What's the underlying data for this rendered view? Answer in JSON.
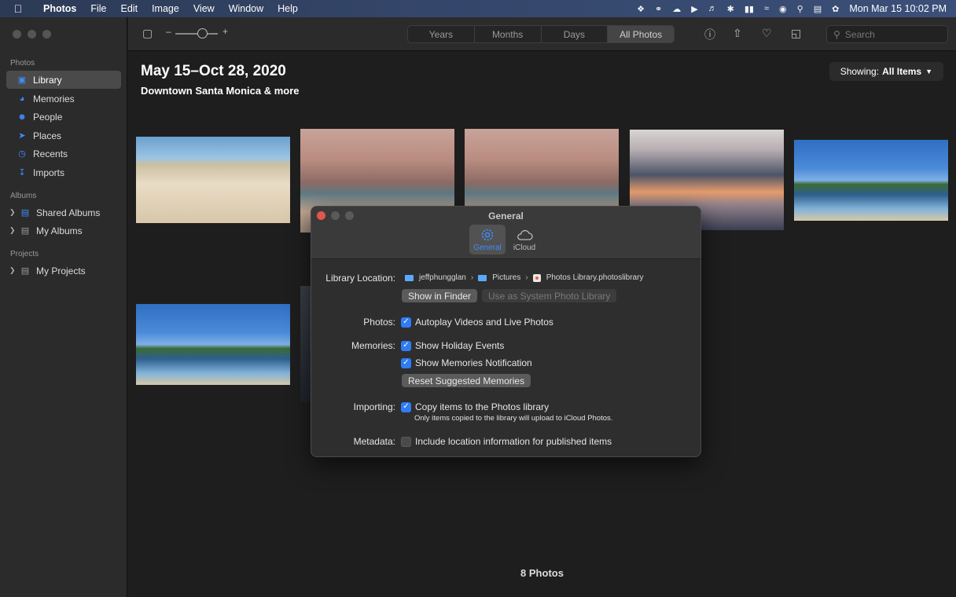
{
  "menubar": {
    "app_name": "Photos",
    "menus": [
      "File",
      "Edit",
      "Image",
      "View",
      "Window",
      "Help"
    ],
    "clock": "Mon Mar 15  10:02 PM",
    "status_icons": [
      "dropbox-icon",
      "creative-cloud-icon",
      "cloud-upload-icon",
      "play-icon",
      "volume-icon",
      "bluetooth-icon",
      "battery-icon",
      "wifi-icon",
      "user-icon",
      "search-icon",
      "control-center-icon",
      "siri-icon"
    ]
  },
  "sidebar": {
    "sections": {
      "photos": "Photos",
      "albums": "Albums",
      "projects": "Projects"
    },
    "photos_items": [
      {
        "label": "Library",
        "icon": "library-icon",
        "active": true
      },
      {
        "label": "Memories",
        "icon": "memories-icon"
      },
      {
        "label": "People",
        "icon": "people-icon"
      },
      {
        "label": "Places",
        "icon": "places-icon"
      },
      {
        "label": "Recents",
        "icon": "recents-icon"
      },
      {
        "label": "Imports",
        "icon": "imports-icon"
      }
    ],
    "album_items": [
      {
        "label": "Shared Albums",
        "icon": "shared-albums-icon"
      },
      {
        "label": "My Albums",
        "icon": "my-albums-icon"
      }
    ],
    "project_items": [
      {
        "label": "My Projects",
        "icon": "my-projects-icon"
      }
    ]
  },
  "toolbar": {
    "zoom_minus": "–",
    "zoom_plus": "+",
    "zoom_level": 0.6,
    "segments": [
      {
        "label": "Years",
        "active": false
      },
      {
        "label": "Months",
        "active": false
      },
      {
        "label": "Days",
        "active": false
      },
      {
        "label": "All Photos",
        "active": true
      }
    ],
    "search_placeholder": "Search"
  },
  "main": {
    "title": "May 15–Oct 28, 2020",
    "subtitle": "Downtown Santa Monica & more",
    "showing_label": "Showing:",
    "showing_value": "All Items",
    "footer_count": "8 Photos"
  },
  "dialog": {
    "title": "General",
    "tabs": [
      {
        "label": "General",
        "active": true
      },
      {
        "label": "iCloud",
        "active": false
      }
    ],
    "library_location_label": "Library Location:",
    "path": [
      "jeffphungglan",
      "Pictures",
      "Photos Library.photoslibrary"
    ],
    "show_in_finder": "Show in Finder",
    "use_as_system": "Use as System Photo Library",
    "photos_label": "Photos:",
    "autoplay": "Autoplay Videos and Live Photos",
    "autoplay_checked": true,
    "memories_label": "Memories:",
    "holiday": "Show Holiday Events",
    "holiday_checked": true,
    "notification": "Show Memories Notification",
    "notification_checked": true,
    "reset_memories": "Reset Suggested Memories",
    "importing_label": "Importing:",
    "copy_items": "Copy items to the Photos library",
    "copy_items_checked": true,
    "copy_note": "Only items copied to the library will upload to iCloud Photos.",
    "metadata_label": "Metadata:",
    "include_location": "Include location information for published items",
    "include_location_checked": false
  },
  "colors": {
    "accent": "#2f7cf6",
    "sidebar_bg": "#2b2b2b",
    "content_bg": "#1e1e1e",
    "dialog_bg": "#2e2e2e"
  }
}
